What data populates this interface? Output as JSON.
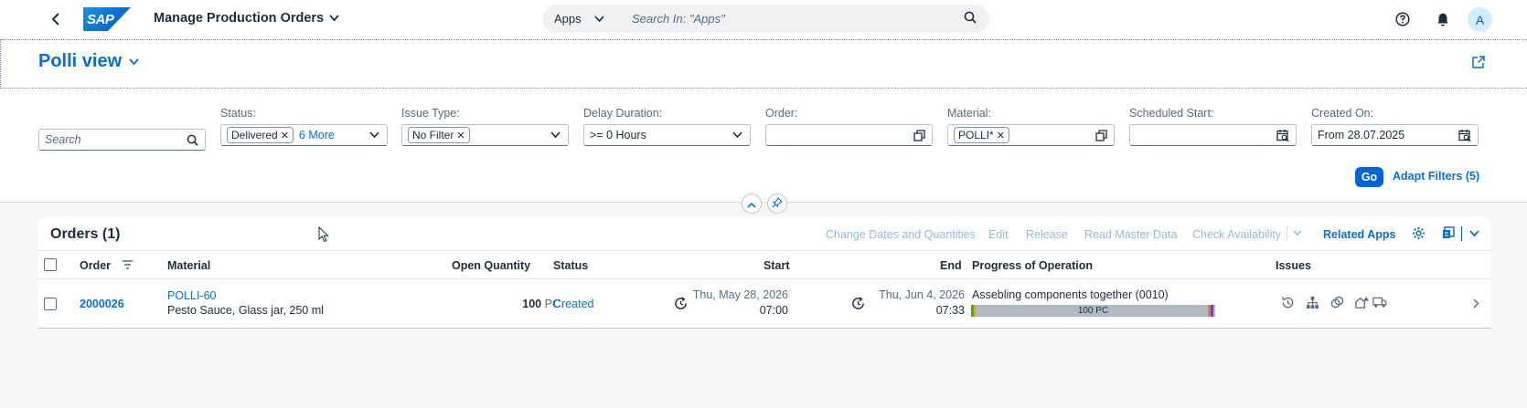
{
  "shell": {
    "logo_text": "SAP",
    "app_title": "Manage Production Orders",
    "search_scope": "Apps",
    "search_placeholder": "Search In: \"Apps\"",
    "avatar_initial": "A"
  },
  "variant": {
    "title": "Polli view"
  },
  "filters": {
    "search_placeholder": "Search",
    "status": {
      "label": "Status:",
      "token": "Delivered",
      "more": "6 More"
    },
    "issue_type": {
      "label": "Issue Type:",
      "token": "No Filter"
    },
    "delay_duration": {
      "label": "Delay Duration:",
      "value": ">= 0 Hours"
    },
    "order": {
      "label": "Order:",
      "value": ""
    },
    "material": {
      "label": "Material:",
      "token": "POLLI*"
    },
    "scheduled_start": {
      "label": "Scheduled Start:",
      "value": ""
    },
    "created_on": {
      "label": "Created On:",
      "value": "From 28.07.2025"
    },
    "go_label": "Go",
    "adapt_label": "Adapt Filters (5)"
  },
  "table": {
    "title": "Orders (1)",
    "toolbar": {
      "change_dates": "Change Dates and Quantities",
      "edit": "Edit",
      "release": "Release",
      "read_master": "Read Master Data",
      "check_availability": "Check Availability",
      "related_apps": "Related Apps"
    },
    "columns": {
      "order": "Order",
      "material": "Material",
      "open_qty": "Open Quantity",
      "status": "Status",
      "start": "Start",
      "end": "End",
      "progress": "Progress of Operation",
      "issues": "Issues"
    },
    "rows": [
      {
        "order": "2000026",
        "material_id": "POLLI-60",
        "material_desc": "Pesto Sauce, Glass jar, 250 ml",
        "qty": "100",
        "unit": "PC",
        "status": "Created",
        "start_date": "Thu, May 28, 2026",
        "start_time": "07:00",
        "end_date": "Thu, Jun 4, 2026",
        "end_time": "07:33",
        "operation": "Assebling components together (0010)",
        "progress_label": "100 PC"
      }
    ]
  },
  "colors": {
    "accent": "#0a6ed1",
    "go": "#0064d9"
  }
}
